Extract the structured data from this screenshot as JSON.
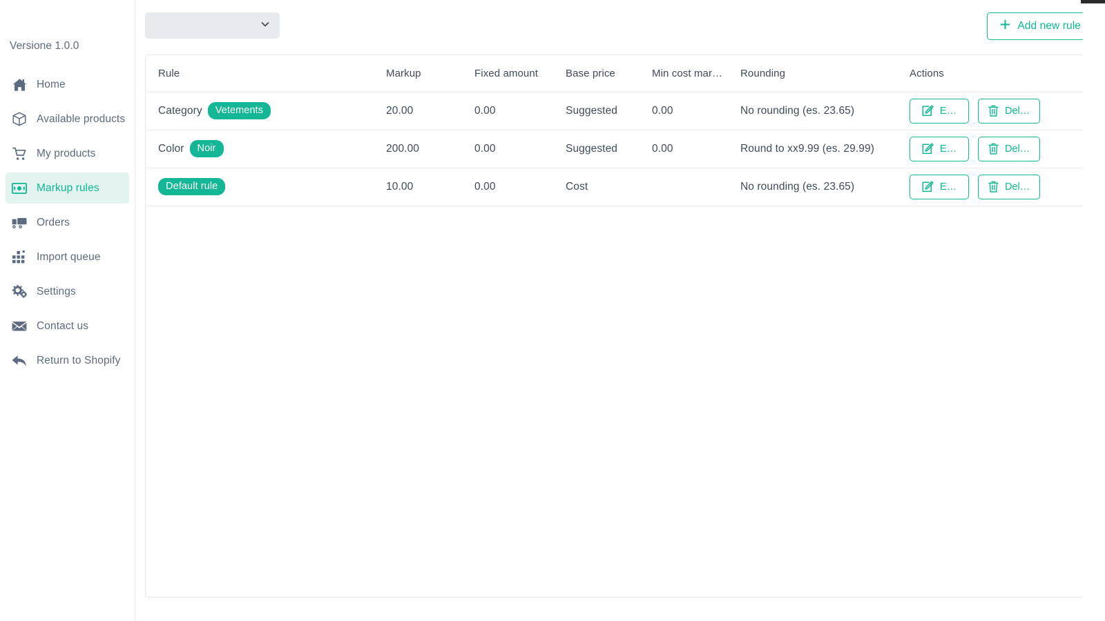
{
  "sidebar": {
    "version": "Versione 1.0.0",
    "items": [
      {
        "label": "Home",
        "icon": "home-icon",
        "active": false
      },
      {
        "label": "Available products",
        "icon": "box-icon",
        "active": false
      },
      {
        "label": "My products",
        "icon": "cart-icon",
        "active": false
      },
      {
        "label": "Markup rules",
        "icon": "banknote-icon",
        "active": true
      },
      {
        "label": "Orders",
        "icon": "truck-icon",
        "active": false
      },
      {
        "label": "Import queue",
        "icon": "grid-icon",
        "active": false
      },
      {
        "label": "Settings",
        "icon": "gears-icon",
        "active": false
      },
      {
        "label": "Contact us",
        "icon": "envelope-icon",
        "active": false
      },
      {
        "label": "Return to Shopify",
        "icon": "back-arrow-icon",
        "active": false
      }
    ]
  },
  "toolbar": {
    "filter_select_value": "",
    "filter_select_placeholder": "",
    "filter_chevron_icon": "chevron-down-icon",
    "add_rule_label": "Add new rule",
    "add_rule_icon": "plus-icon"
  },
  "table": {
    "headers": [
      "Rule",
      "Markup",
      "Fixed amount",
      "Base price",
      "Min cost mar…",
      "Rounding",
      "Actions"
    ],
    "rows": [
      {
        "rule_prefix": "Category",
        "rule_badge": "Vetements",
        "markup": "20.00",
        "fixed_amount": "0.00",
        "base_price": "Suggested",
        "min_cost_margin": "0.00",
        "rounding": "No rounding (es. 23.65)",
        "edit_label": "E…",
        "delete_label": "Del…"
      },
      {
        "rule_prefix": "Color",
        "rule_badge": "Noir",
        "markup": "200.00",
        "fixed_amount": "0.00",
        "base_price": "Suggested",
        "min_cost_margin": "0.00",
        "rounding": "Round to xx9.99 (es. 29.99)",
        "edit_label": "E…",
        "delete_label": "Del…"
      },
      {
        "rule_prefix": "",
        "rule_badge": "Default rule",
        "markup": "10.00",
        "fixed_amount": "0.00",
        "base_price": "Cost",
        "min_cost_margin": "",
        "rounding": "No rounding (es. 23.65)",
        "edit_label": "E…",
        "delete_label": "Del…"
      }
    ],
    "edit_icon": "pencil-edit-icon",
    "delete_icon": "trash-icon"
  },
  "colors": {
    "accent_teal": "#10b795",
    "badge_teal": "#13b795",
    "active_nav_bg": "#e3f4f0",
    "text_slate": "#3e4b5b",
    "muted_slate": "#5c6b7f",
    "border_gray": "#e6e9ec",
    "select_bg": "#e7ebee"
  }
}
